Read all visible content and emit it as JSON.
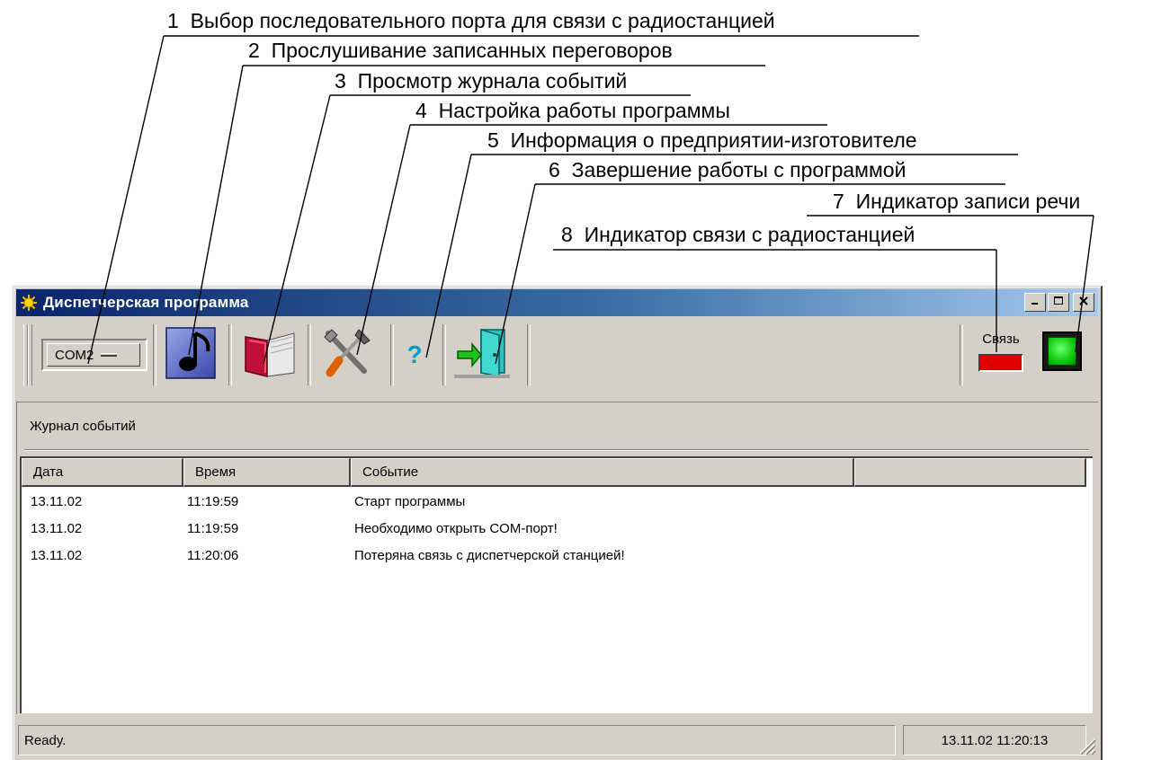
{
  "callouts": [
    {
      "num": "1",
      "text": "Выбор последовательного порта для связи с радиостанцией"
    },
    {
      "num": "2",
      "text": "Прослушивание записанных переговоров"
    },
    {
      "num": "3",
      "text": "Просмотр журнала событий"
    },
    {
      "num": "4",
      "text": "Настройка работы программы"
    },
    {
      "num": "5",
      "text": "Информация о предприятии-изготовителе"
    },
    {
      "num": "6",
      "text": "Завершение работы с программой"
    },
    {
      "num": "7",
      "text": "Индикатор записи речи"
    },
    {
      "num": "8",
      "text": "Индикатор связи с радиостанцией"
    }
  ],
  "window": {
    "title": "Диспетчерская программа",
    "icon": "sun-icon",
    "controls": [
      "minimize-icon",
      "maximize-icon",
      "close-icon"
    ]
  },
  "toolbar": {
    "port_selected": "COM2",
    "tools": [
      {
        "name": "play-recordings",
        "icon": "music-note-icon"
      },
      {
        "name": "event-log",
        "icon": "book-icon"
      },
      {
        "name": "settings",
        "icon": "tools-icon"
      },
      {
        "name": "about",
        "icon": "question-icon",
        "glyph": "?"
      },
      {
        "name": "exit",
        "icon": "exit-door-icon"
      }
    ],
    "link_label": "Связь",
    "link_status_color": "#e00000",
    "record_status_color": "#00c000"
  },
  "log": {
    "title": "Журнал событий",
    "columns": [
      "Дата",
      "Время",
      "Событие",
      ""
    ],
    "rows": [
      {
        "date": "13.11.02",
        "time": "11:19:59",
        "event": "Старт программы"
      },
      {
        "date": "13.11.02",
        "time": "11:19:59",
        "event": "Необходимо открыть COM-порт!"
      },
      {
        "date": "13.11.02",
        "time": "11:20:06",
        "event": "Потеряна связь с диспетчерской станцией!"
      }
    ]
  },
  "status": {
    "text": "Ready.",
    "datetime": "13.11.02 11:20:13"
  }
}
